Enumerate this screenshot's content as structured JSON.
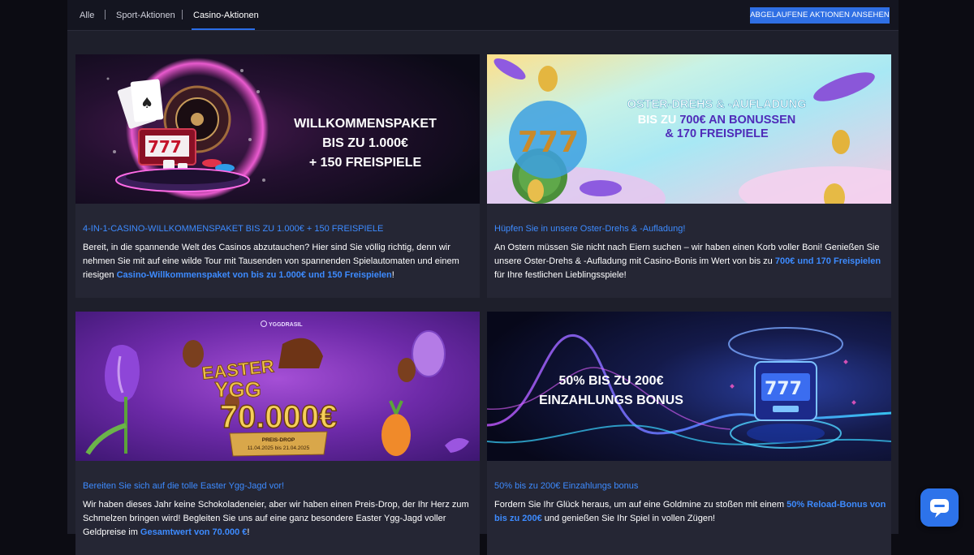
{
  "tabs": [
    {
      "label": "Alle",
      "active": false
    },
    {
      "label": "Sport-Aktionen",
      "active": false
    },
    {
      "label": "Casino-Aktionen",
      "active": true
    }
  ],
  "expired_button": "ABGELAUFENE AKTIONEN ANSEHEN",
  "promos": [
    {
      "banner": {
        "line1": "WILLKOMMENSPAKET",
        "line2": "BIS ZU 1.000€",
        "line3": "+ 150 FREISPIELE"
      },
      "title": "4-IN-1-CASINO-WILLKOMMENSPAKET BIS ZU 1.000€ + 150 FREISPIELE",
      "body_before": "Bereit, in die spannende Welt des Casinos abzutauchen? Hier sind Sie völlig richtig, denn wir nehmen Sie mit auf eine wilde Tour mit Tausenden von spannenden Spielautomaten und einem riesigen ",
      "body_highlight": "Casino-Willkommenspaket von bis zu 1.000€ und 150 Freispielen",
      "body_after": "!"
    },
    {
      "banner": {
        "line1": "OSTER-DREHS & -AUFLADUNG",
        "line2_prefix": "BIS ZU ",
        "line2_amount": "700€",
        "line2_suffix": " AN BONUSSEN",
        "line3": "& 170 FREISPIELE"
      },
      "title": "Hüpfen Sie in unsere Oster-Drehs & -Aufladung!",
      "body_before": "An Ostern müssen Sie nicht nach Eiern suchen – wir haben einen Korb voller Boni! Genießen Sie unsere Oster-Drehs & -Aufladung mit Casino-Bonis im Wert von bis zu ",
      "body_highlight": "700€ und 170 Freispielen",
      "body_after": " für Ihre festlichen Lieblingsspiele!"
    },
    {
      "banner": {
        "brand": "YGGDRASIL",
        "line1": "EASTER",
        "line2": "YGG",
        "amount": "70.000€",
        "drop_label": "PREIS-DROP",
        "dates": "11.04.2025 bis 21.04.2025"
      },
      "title": "Bereiten Sie sich auf die tolle Easter Ygg-Jagd vor!",
      "body_before": "Wir haben dieses Jahr keine Schokoladeneier, aber wir haben einen Preis-Drop, der Ihr Herz zum Schmelzen bringen wird! Begleiten Sie uns auf eine ganz besondere Easter Ygg-Jagd voller Geldpreise im ",
      "body_highlight": "Gesamtwert von 70.000 €",
      "body_after": "!"
    },
    {
      "banner": {
        "line1": "50% BIS ZU 200€",
        "line2": "EINZAHLUNGS BONUS"
      },
      "title": "50% bis zu 200€ Einzahlungs bonus",
      "body_before": "Fordern Sie Ihr Glück heraus, um auf eine Goldmine zu stoßen mit einem ",
      "body_highlight": "50% Reload-Bonus von bis zu 200€",
      "body_after": " und genießen Sie Ihr Spiel in vollen Zügen!"
    }
  ],
  "icons": {
    "chat": "chat-bubble-icon"
  }
}
